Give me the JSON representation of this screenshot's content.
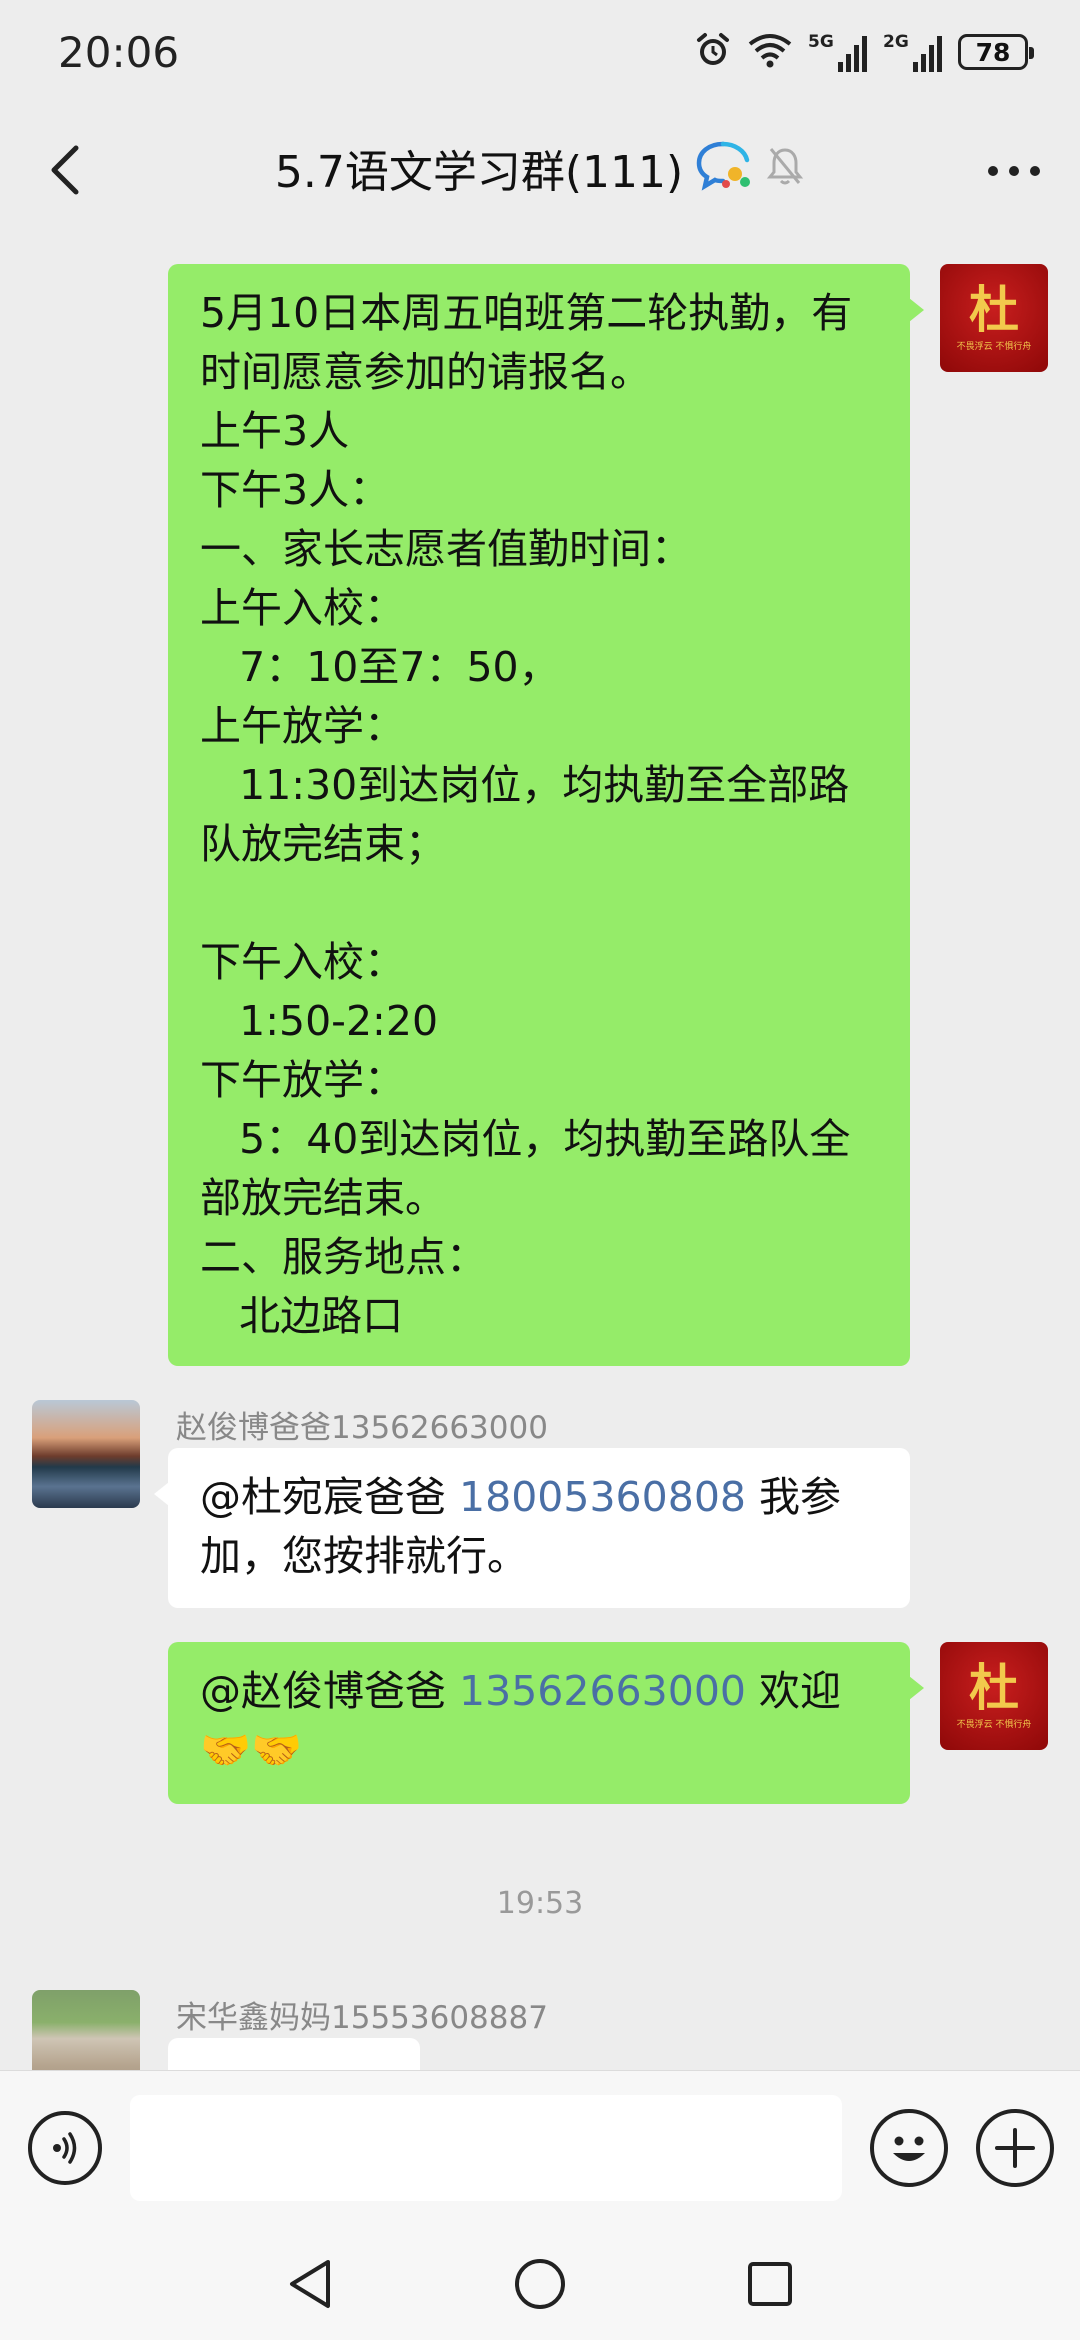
{
  "status_bar": {
    "time": "20:06",
    "signal_1_label": "5G",
    "signal_2_label": "2G",
    "battery_level": "78",
    "icons": [
      "alarm-icon",
      "wifi-icon",
      "signal-icon",
      "battery-icon"
    ]
  },
  "header": {
    "title": "5.7语文学习群(111)",
    "icons": [
      "back-arrow-icon",
      "group-chat-icon",
      "mute-bell-icon",
      "more-dots-icon"
    ]
  },
  "messages": [
    {
      "side": "me",
      "text": "5月10日本周五咱班第二轮执勤，有时间愿意参加的请报名。\n上午3人\n下午3人：\n一、家长志愿者值勤时间：\n上午入校：\n   7：10至7：50，\n上午放学：\n   11:30到达岗位，均执勤至全部路队放完结束；\n\n下午入校：\n   1:50-2:20\n下午放学：\n   5：40到达岗位，均执勤至路队全部放完结束。\n二、服务地点：\n   北边路口"
    },
    {
      "side": "other",
      "sender": "赵俊博爸爸13562663000",
      "mention": "@杜宛宸爸爸 ",
      "phone": "18005360808",
      "rest": " 我参加，您按排就行。"
    },
    {
      "side": "me",
      "mention": "@赵俊博爸爸 ",
      "phone": "13562663000",
      "rest": " 欢迎🤝🤝"
    },
    {
      "type": "time",
      "text": "19:53"
    },
    {
      "side": "other",
      "sender": "宋华鑫妈妈15553608887",
      "text": ""
    }
  ],
  "avatars": {
    "du_char": "杜",
    "du_tag": "不畏浮云  不惧行舟"
  },
  "input_bar": {
    "placeholder": "",
    "icons": [
      "voice-icon",
      "emoji-icon",
      "plus-icon"
    ]
  },
  "nav_bar": {
    "icons": [
      "nav-back-icon",
      "nav-home-icon",
      "nav-recent-icon"
    ]
  },
  "colors": {
    "my_bubble": "#95ec69",
    "other_bubble": "#ffffff",
    "background": "#ededed",
    "phone_link": "#4a6fa5"
  }
}
